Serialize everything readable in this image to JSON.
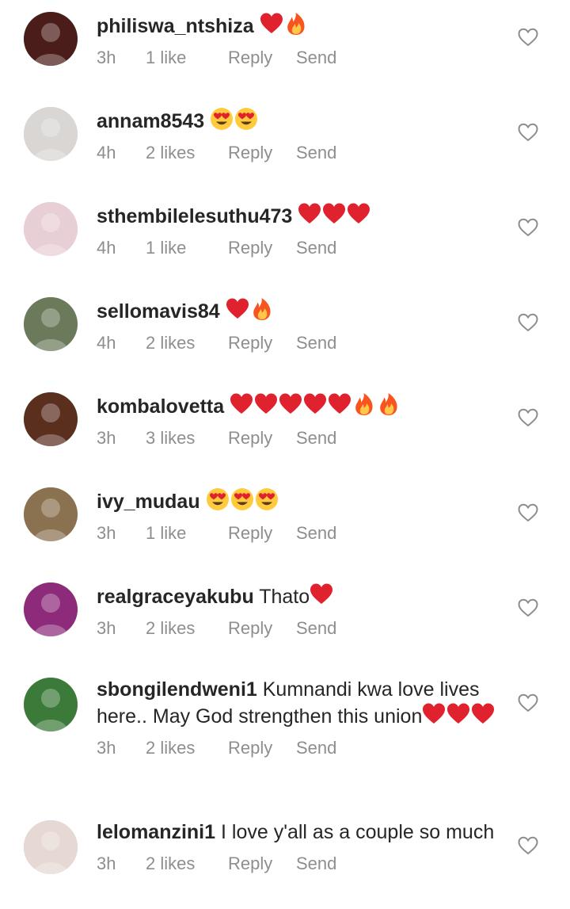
{
  "colors": {
    "text": "#262626",
    "meta": "#8e8e8e",
    "emoji_heart": "#e0212e",
    "emoji_fire": "#f7541f",
    "emoji_face": "#ffcb3d",
    "background": "#ffffff"
  },
  "actions": {
    "reply": "Reply",
    "send": "Send"
  },
  "like_icon": "heart-outline-icon",
  "comments": [
    {
      "username": "philiswa_ntshiza",
      "text": "",
      "emojis": [
        "heart",
        "fire"
      ],
      "time": "3h",
      "likes": "1 like",
      "avatar_color": "#4a1d1a"
    },
    {
      "username": "annam8543",
      "text": "",
      "emojis": [
        "heart-eyes",
        "heart-eyes"
      ],
      "time": "4h",
      "likes": "2 likes",
      "avatar_color": "#d9d6d4"
    },
    {
      "username": "sthembilelesuthu473",
      "text": "",
      "emojis": [
        "heart",
        "heart",
        "heart"
      ],
      "time": "4h",
      "likes": "1 like",
      "avatar_color": "#e8cfd6"
    },
    {
      "username": "sellomavis84",
      "text": "",
      "emojis": [
        "heart",
        "fire"
      ],
      "time": "4h",
      "likes": "2 likes",
      "avatar_color": "#6b7a5a"
    },
    {
      "username": "kombalovetta",
      "text": "",
      "emojis": [
        "heart",
        "heart",
        "heart",
        "heart",
        "heart",
        "fire",
        "fire"
      ],
      "time": "3h",
      "likes": "3 likes",
      "avatar_color": "#5a2f1e"
    },
    {
      "username": "ivy_mudau",
      "text": "",
      "emojis": [
        "heart-eyes",
        "heart-eyes",
        "heart-eyes"
      ],
      "time": "3h",
      "likes": "1 like",
      "avatar_color": "#8a7250"
    },
    {
      "username": "realgraceyakubu",
      "text": "Thato",
      "emojis": [
        "heart"
      ],
      "time": "3h",
      "likes": "2 likes",
      "avatar_color": "#8e2a7a"
    },
    {
      "username": "sbongilendweni1",
      "text": "Kumnandi kwa love lives here.. May God strengthen this union",
      "emojis": [
        "heart",
        "heart",
        "heart"
      ],
      "time": "3h",
      "likes": "2 likes",
      "avatar_color": "#3c7a3a"
    },
    {
      "username": "lelomanzini1",
      "text": "I love y'all as a couple so much",
      "emojis": [],
      "time": "3h",
      "likes": "2 likes",
      "avatar_color": "#e6d8d2"
    }
  ]
}
